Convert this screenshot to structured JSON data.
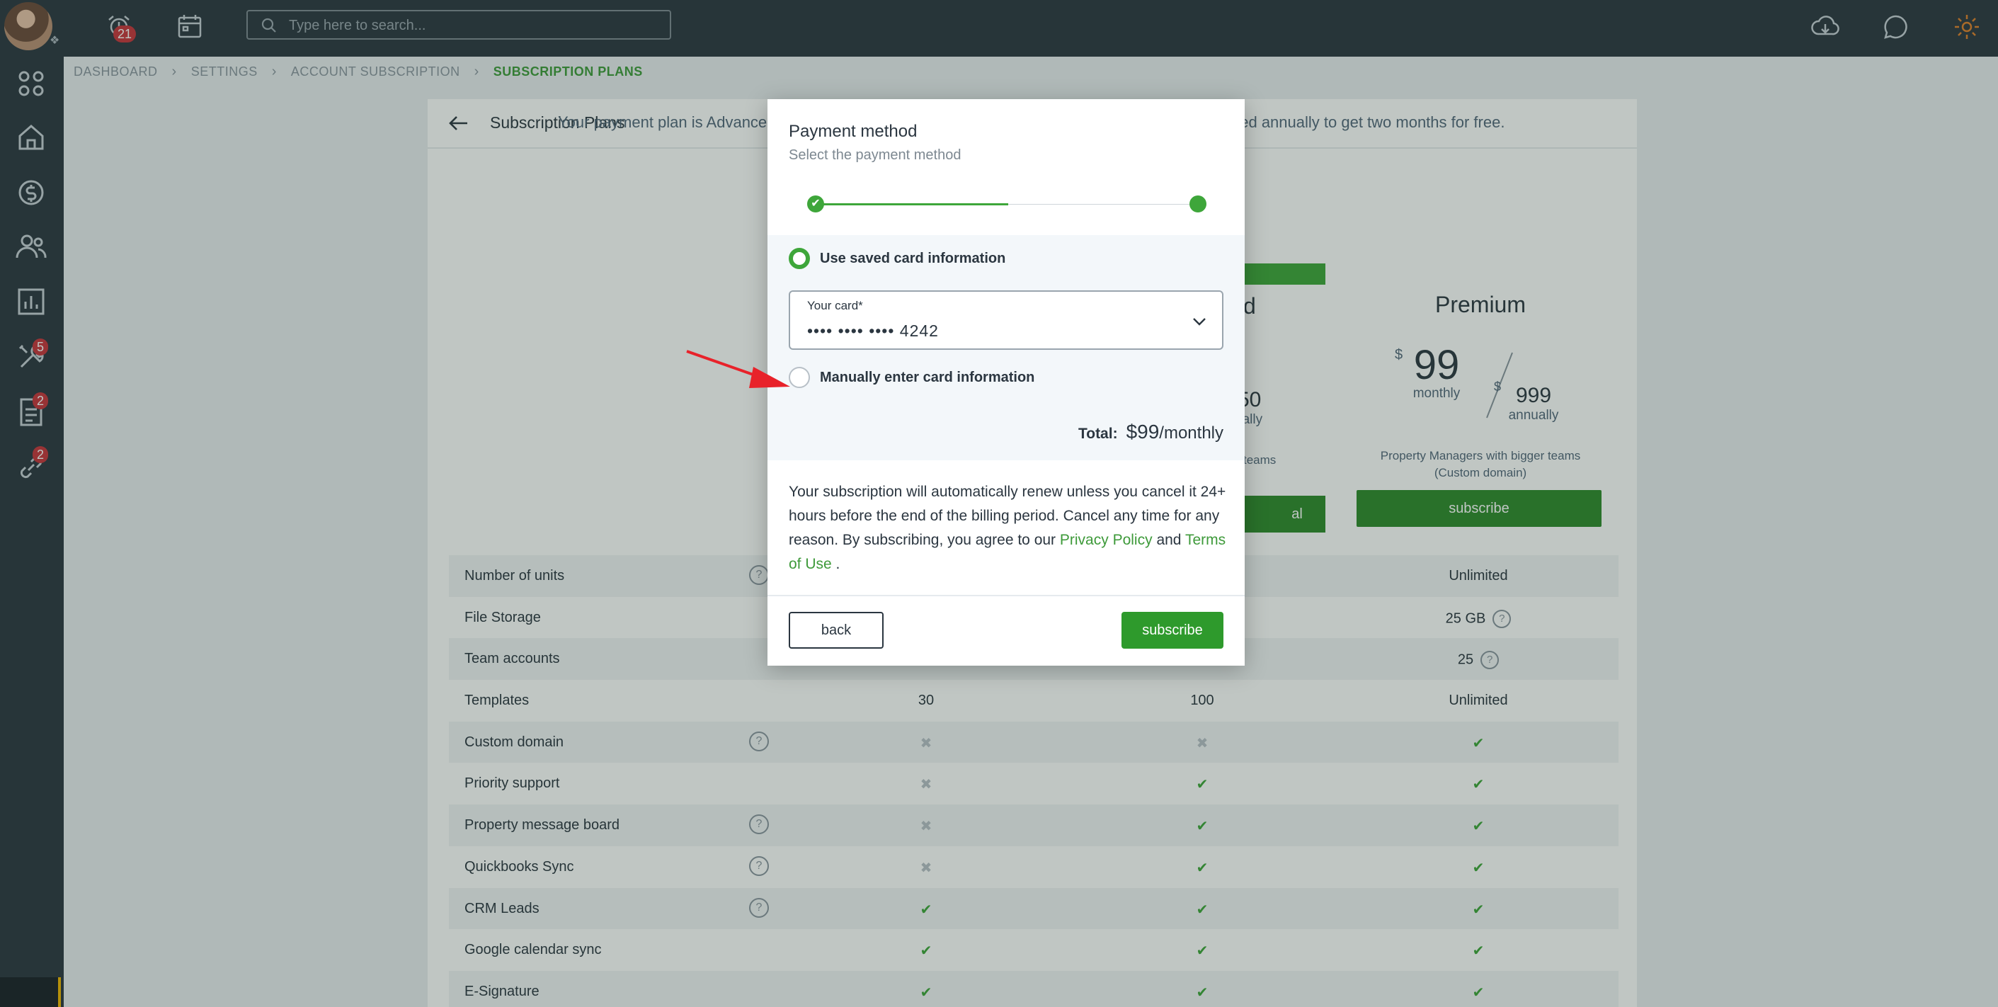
{
  "topbar": {
    "notifications_count": "21",
    "search_placeholder": "Type here to search..."
  },
  "sidebar": {
    "badges": {
      "tools": "5",
      "documents": "2",
      "links": "2"
    }
  },
  "breadcrumb": [
    "DASHBOARD",
    "SETTINGS",
    "ACCOUNT SUBSCRIPTION",
    "SUBSCRIPTION PLANS"
  ],
  "page": {
    "title": "Subscription Plans",
    "plan_text_left": "Your payment plan is Advanced",
    "plan_text_right": "nced annually to get two months for free."
  },
  "plans": {
    "standard_fragment": {
      "name_tail": "d",
      "price_tail": "50",
      "annual_tail": "ually",
      "desc_tail": "teams",
      "button_tail": "al"
    },
    "premium": {
      "name": "Premium",
      "currency": "$",
      "monthly_price": "99",
      "monthly_label": "monthly",
      "annual_price": "999",
      "annual_label": "annually",
      "description": "Property Managers with bigger teams (Custom domain)",
      "button": "subscribe"
    }
  },
  "features": [
    {
      "label": "Number of units",
      "help": true,
      "basic": "",
      "standard": "",
      "premium": "Unlimited"
    },
    {
      "label": "File Storage",
      "help": false,
      "basic": "",
      "standard": "",
      "premium": "25 GB",
      "premium_help": true
    },
    {
      "label": "Team accounts",
      "help": false,
      "basic": "",
      "standard": "",
      "premium": "25",
      "premium_help": true
    },
    {
      "label": "Templates",
      "help": false,
      "basic": "30",
      "standard": "100",
      "premium": "Unlimited"
    },
    {
      "label": "Custom domain",
      "help": true,
      "basic": "✖",
      "standard": "✖",
      "premium": "✔"
    },
    {
      "label": "Priority support",
      "help": false,
      "basic": "✖",
      "standard": "✔",
      "premium": "✔"
    },
    {
      "label": "Property message board",
      "help": true,
      "basic": "✖",
      "standard": "✔",
      "premium": "✔"
    },
    {
      "label": "Quickbooks Sync",
      "help": true,
      "basic": "✖",
      "standard": "✔",
      "premium": "✔"
    },
    {
      "label": "CRM Leads",
      "help": true,
      "basic": "✔",
      "standard": "✔",
      "premium": "✔"
    },
    {
      "label": "Google calendar sync",
      "help": false,
      "basic": "✔",
      "standard": "✔",
      "premium": "✔"
    },
    {
      "label": "E-Signature",
      "help": false,
      "basic": "✔",
      "standard": "✔",
      "premium": "✔"
    }
  ],
  "modal": {
    "title": "Payment method",
    "subtitle": "Select the payment method",
    "option_saved": "Use saved card information",
    "card_label": "Your card*",
    "card_value": "•••• •••• •••• 4242",
    "option_manual": "Manually enter card information",
    "total_label": "Total:",
    "total_amount": "$99",
    "total_period": "/monthly",
    "terms_text": "Your subscription will automatically renew unless you cancel it 24+ hours before the end of the billing period. Cancel any time for any reason. By subscribing, you agree to our",
    "privacy_link": "Privacy Policy",
    "and_text": "and",
    "terms_link": "Terms of Use",
    "terms_end": ".",
    "back_button": "back",
    "subscribe_button": "subscribe"
  },
  "colors": {
    "brand_green": "#3ea63a",
    "dark_nav": "#2b3640",
    "badge_red": "#c8343b",
    "annotation_arrow": "#e8222a"
  }
}
